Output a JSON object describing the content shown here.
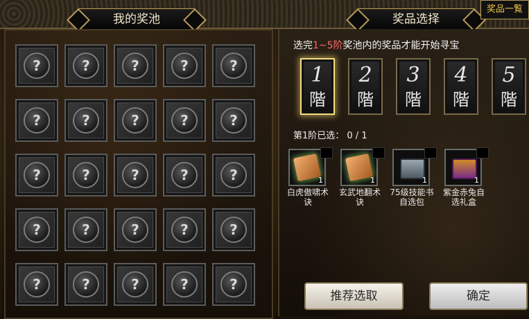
{
  "header": {
    "left_title": "我的奖池",
    "right_title": "奖品选择",
    "corner_button": "奖品一覧"
  },
  "pool": {
    "slot_symbol": "?",
    "slots": 25
  },
  "selection": {
    "instruction_prefix": "选完",
    "instruction_highlight": "1~5阶",
    "instruction_suffix": "奖池内的奖品才能开始寻宝",
    "progress": "第1阶已选： 0 / 1"
  },
  "tiers": [
    {
      "num": "1",
      "label": "階",
      "selected": true
    },
    {
      "num": "2",
      "label": "階",
      "selected": false
    },
    {
      "num": "3",
      "label": "階",
      "selected": false
    },
    {
      "num": "4",
      "label": "階",
      "selected": false
    },
    {
      "num": "5",
      "label": "階",
      "selected": false
    }
  ],
  "rewards": [
    {
      "name": "白虎傲啸术诀",
      "qty": "1",
      "icon": "book-icon"
    },
    {
      "name": "玄武地翻术诀",
      "qty": "1",
      "icon": "book-icon"
    },
    {
      "name": "75级技能书自选包",
      "qty": "1",
      "icon": "chest-icon"
    },
    {
      "name": "紫金赤兔自选礼盒",
      "qty": "1",
      "icon": "treasure-chest-icon"
    }
  ],
  "buttons": {
    "recommend": "推荐选取",
    "confirm": "确定"
  },
  "colors": {
    "highlight": "#ff6a6a",
    "gold_border": "#b89a5a",
    "corner_text": "#f0c64a"
  }
}
